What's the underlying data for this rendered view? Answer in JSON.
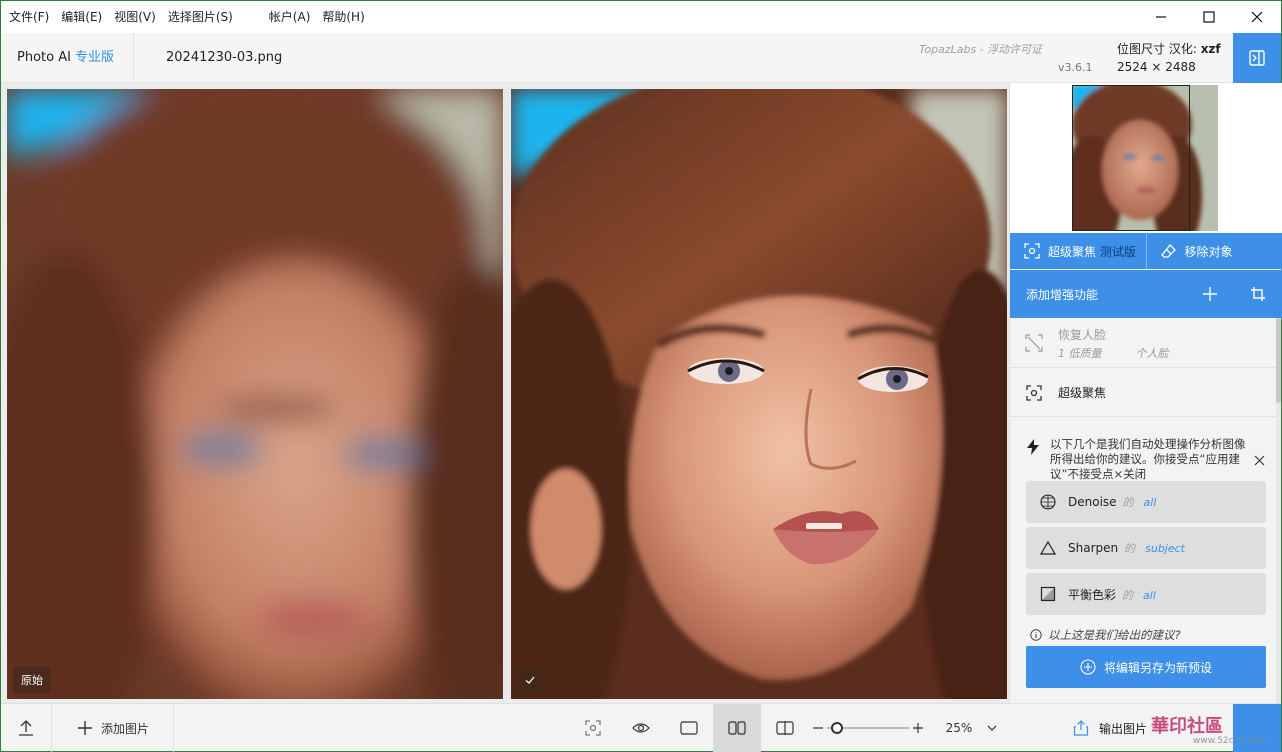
{
  "menu": {
    "items": [
      "文件(F)",
      "编辑(E)",
      "视图(V)",
      "选择图片(S)"
    ],
    "items_right": [
      "帐户(A)",
      "帮助(H)"
    ]
  },
  "header": {
    "app_name": "Photo AI",
    "edition": "专业版",
    "filename": "20241230-03.png",
    "license": "TopazLabs - 浮动许可证",
    "version": "v3.6.1",
    "size_label": "位图尺寸 汉化:",
    "size_author": "xzf",
    "size_value": "2524 × 2488"
  },
  "canvas": {
    "left_label": "原始"
  },
  "panel": {
    "tools": [
      {
        "label": "超级聚焦",
        "beta": "测试版"
      },
      {
        "label": "移除对象"
      }
    ],
    "add_label": "添加增强功能",
    "features": [
      {
        "title": "恢复人脸",
        "sub1": "1 低质量",
        "sub2": "个人脸"
      },
      {
        "title": "超级聚焦"
      }
    ],
    "suggest_text": "以下几个是我们自动处理操作分析图像所得出给你的建议。你接受点“应用建议”不接受点×关闭",
    "suggestions": [
      {
        "name": "Denoise",
        "of": "的",
        "target": "all"
      },
      {
        "name": "Sharpen",
        "of": "的",
        "target": "subject"
      },
      {
        "name": "平衡色彩",
        "of": "的",
        "target": "all"
      }
    ],
    "question": "以上这是我们给出的建议?",
    "save_preset": "将编辑另存为新预设"
  },
  "bottom": {
    "add_image": "添加图片",
    "zoom": "25%",
    "zoom_fraction": 0.05,
    "export": "输出图片",
    "watermark": "華印社區",
    "watermark_url": "www.52cnp.com"
  },
  "colors": {
    "accent": "#3d8fe8",
    "edition": "#2f8fe8"
  }
}
